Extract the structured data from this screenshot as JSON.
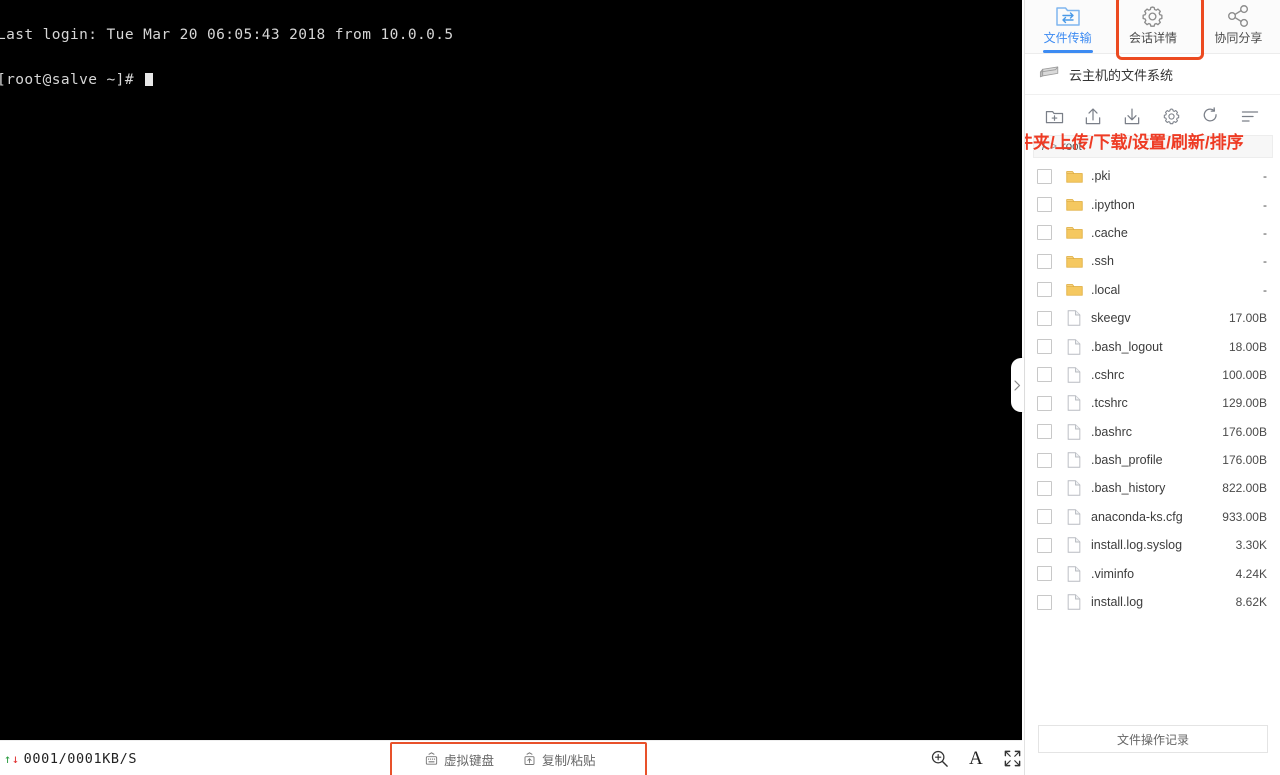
{
  "terminal": {
    "line1": "Last login: Tue Mar 20 06:05:43 2018 from 10.0.0.5",
    "line2": "[root@salve ~]# "
  },
  "status_bar": {
    "speed_text": "0001/0001KB/S",
    "up_arrow": "↑",
    "down_arrow": "↓",
    "virtual_keyboard_label": "虚拟键盘",
    "copy_paste_label": "复制/粘贴",
    "font_size_label": "A"
  },
  "panel": {
    "tabs": [
      {
        "label": "文件传输",
        "icon": "file-transfer-icon",
        "active": true
      },
      {
        "label": "会话详情",
        "icon": "gear-icon",
        "active": false
      },
      {
        "label": "协同分享",
        "icon": "share-icon",
        "active": false
      }
    ],
    "filesystem_title": "云主机的文件系统",
    "toolbar": [
      {
        "name": "new-folder-icon",
        "title": "新增文件夹"
      },
      {
        "name": "upload-icon",
        "title": "上传"
      },
      {
        "name": "download-icon",
        "title": "下载"
      },
      {
        "name": "settings-gear-icon",
        "title": "设置"
      },
      {
        "name": "refresh-icon",
        "title": "刷新"
      },
      {
        "name": "sort-icon",
        "title": "排序"
      }
    ],
    "annotation": "新增文件夹/上传/下载/设置/刷新/排序",
    "breadcrumb": {
      "root": "/",
      "separator": ">",
      "current": "root"
    },
    "footer_button": "文件操作记录",
    "files": [
      {
        "name": ".pki",
        "size": "-",
        "type": "folder"
      },
      {
        "name": ".ipython",
        "size": "-",
        "type": "folder"
      },
      {
        "name": ".cache",
        "size": "-",
        "type": "folder"
      },
      {
        "name": ".ssh",
        "size": "-",
        "type": "folder"
      },
      {
        "name": ".local",
        "size": "-",
        "type": "folder"
      },
      {
        "name": "skeegv",
        "size": "17.00B",
        "type": "file"
      },
      {
        "name": ".bash_logout",
        "size": "18.00B",
        "type": "file"
      },
      {
        "name": ".cshrc",
        "size": "100.00B",
        "type": "file"
      },
      {
        "name": ".tcshrc",
        "size": "129.00B",
        "type": "file"
      },
      {
        "name": ".bashrc",
        "size": "176.00B",
        "type": "file"
      },
      {
        "name": ".bash_profile",
        "size": "176.00B",
        "type": "file"
      },
      {
        "name": ".bash_history",
        "size": "822.00B",
        "type": "file"
      },
      {
        "name": "anaconda-ks.cfg",
        "size": "933.00B",
        "type": "file"
      },
      {
        "name": "install.log.syslog",
        "size": "3.30K",
        "type": "file"
      },
      {
        "name": ".viminfo",
        "size": "4.24K",
        "type": "file"
      },
      {
        "name": "install.log",
        "size": "8.62K",
        "type": "file"
      }
    ]
  },
  "colors": {
    "accent_blue": "#3d8bf2",
    "annotation_red": "#ee3b24",
    "highlight_orange": "#e8512a",
    "folder_yellow": "#f5c860",
    "terminal_bg": "#000000",
    "terminal_fg": "#d6d6d6"
  }
}
